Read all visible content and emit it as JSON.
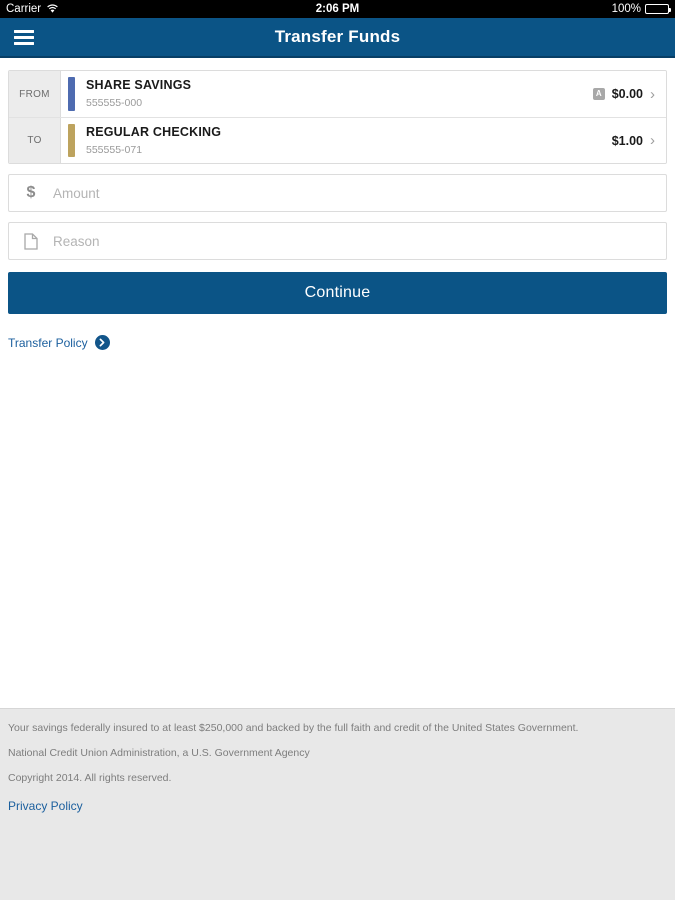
{
  "status_bar": {
    "carrier": "Carrier",
    "wifi_icon": "wifi-icon",
    "time": "2:06 PM",
    "battery_percent": "100%",
    "battery_icon": "battery-full-icon"
  },
  "nav": {
    "menu_icon": "hamburger-menu-icon",
    "title": "Transfer Funds"
  },
  "transfer": {
    "accounts": [
      {
        "direction_label": "FROM",
        "name": "SHARE SAVINGS",
        "number": "555555-000",
        "balance": "$0.00",
        "badge": "A",
        "has_badge": true,
        "color": "#4e6bb0"
      },
      {
        "direction_label": "TO",
        "name": "REGULAR CHECKING",
        "number": "555555-071",
        "balance": "$1.00",
        "badge": "",
        "has_badge": false,
        "color": "#bda35e"
      }
    ],
    "amount_field": {
      "icon": "dollar-sign-icon",
      "symbol": "$",
      "value": "",
      "placeholder": "Amount"
    },
    "reason_field": {
      "icon": "document-icon",
      "value": "",
      "placeholder": "Reason"
    },
    "continue_label": "Continue",
    "policy_link": "Transfer Policy",
    "policy_arrow_icon": "arrow-right-circle-icon"
  },
  "footer": {
    "line1": "Your savings federally insured to at least $250,000 and backed by the full faith and credit of the United States Government.",
    "line2": "National Credit Union Administration, a U.S. Government Agency",
    "line3": "Copyright 2014. All rights reserved.",
    "privacy_policy": "Privacy Policy"
  },
  "colors": {
    "brand_blue": "#0b5486",
    "link_blue": "#1b5f9e",
    "savings_accent": "#4e6bb0",
    "checking_accent": "#bda35e"
  }
}
